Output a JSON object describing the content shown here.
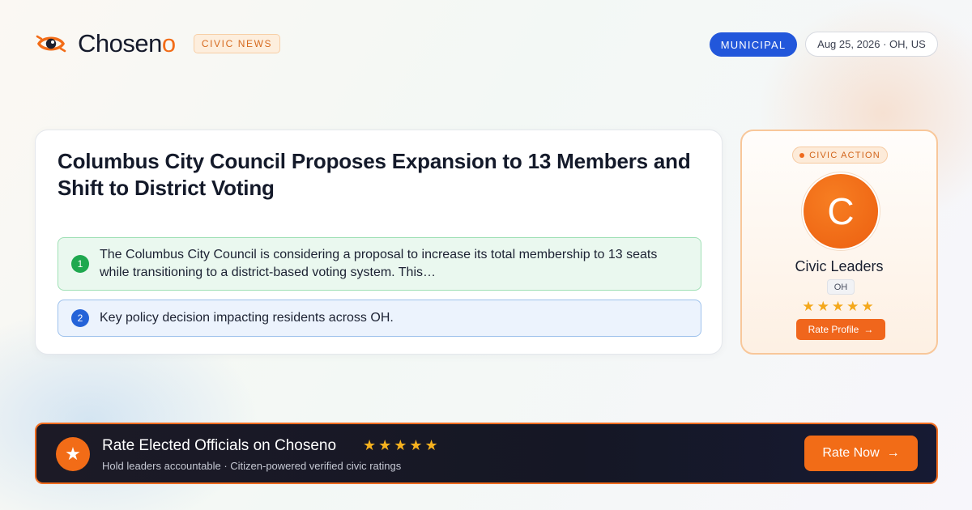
{
  "brand": {
    "name_part1": "Chosen",
    "name_part2": "o",
    "tag": "CIVIC NEWS",
    "icon": "eye-logo-icon",
    "accent_color": "#f26c17"
  },
  "header": {
    "category": "MUNICIPAL",
    "dateline": "Aug 25, 2026 · OH, US",
    "category_color": "#2257db"
  },
  "article": {
    "headline": "Columbus City Council Proposes Expansion to 13 Members and Shift to District Voting",
    "points": [
      {
        "number": "1",
        "text": "The Columbus City Council is considering a proposal to increase its total membership to 13 seats while transitioning to a district-based voting system. This…",
        "color": "#1fa84f"
      },
      {
        "number": "2",
        "text": "Key policy decision impacting residents across OH.",
        "color": "#2463d8"
      }
    ]
  },
  "side_card": {
    "badge": "CIVIC ACTION",
    "avatar_initial": "C",
    "name": "Civic Leaders",
    "state": "OH",
    "stars": "★★★★★",
    "rating": 5,
    "button_label": "Rate Profile",
    "button_icon": "arrow-right-icon"
  },
  "banner": {
    "icon": "star-icon",
    "star_glyph": "★",
    "title": "Rate Elected Officials on Choseno",
    "stars": "★★★★★",
    "subtitle": "Hold leaders accountable · Citizen-powered verified civic ratings",
    "button_label": "Rate Now",
    "button_icon": "arrow-right-icon"
  }
}
